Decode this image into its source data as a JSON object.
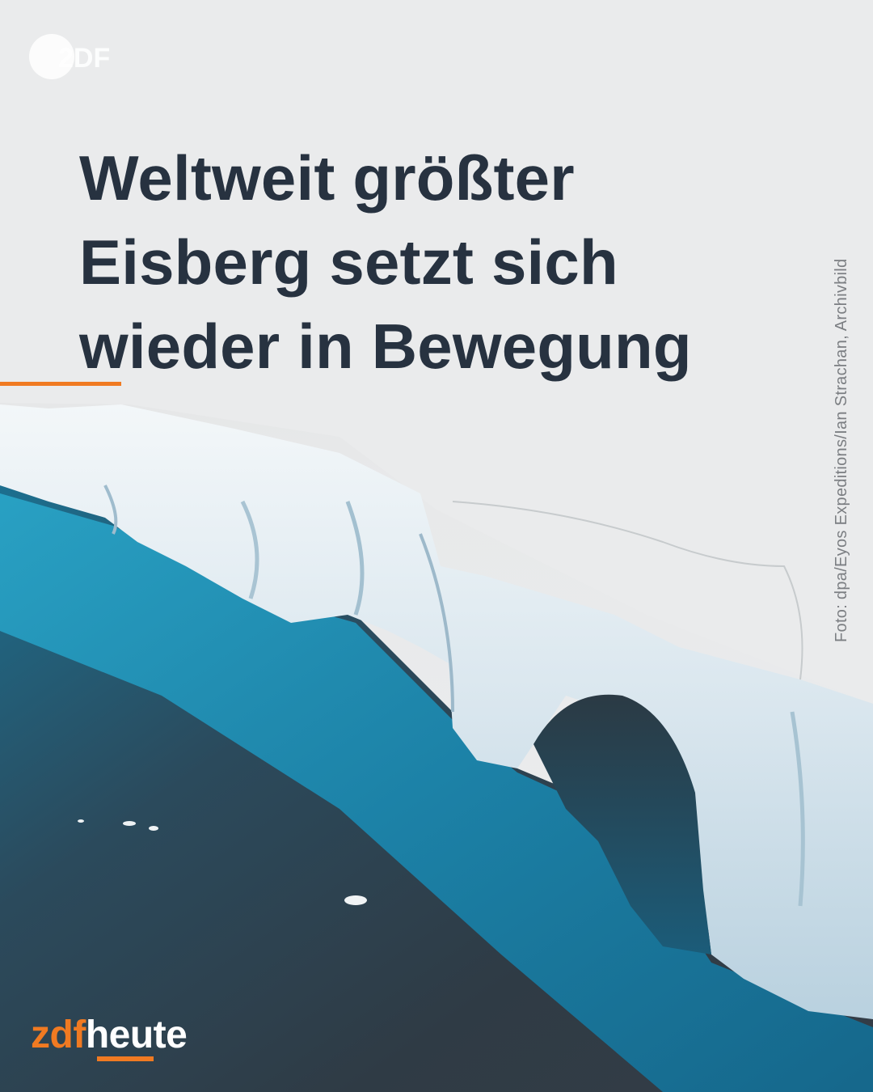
{
  "headline": {
    "lines": [
      "Weltweit größter",
      "Eisberg setzt sich",
      "wieder in Bewegung"
    ]
  },
  "photo_credit": "Foto: dpa/Eyos Expeditions/Ian Strachan, Archivbild",
  "corner_logo": {
    "icon": "zdf-logo-icon",
    "text": "ZDF"
  },
  "brand": {
    "part1": "zdf",
    "part2": "heute"
  },
  "colors": {
    "headline": "#273240",
    "accent": "#f07a22",
    "sky": "#e6e7e8",
    "ice": "#eef3f6",
    "water_turquoise": "#1f8fb0",
    "water_dark": "#2f3a44"
  }
}
